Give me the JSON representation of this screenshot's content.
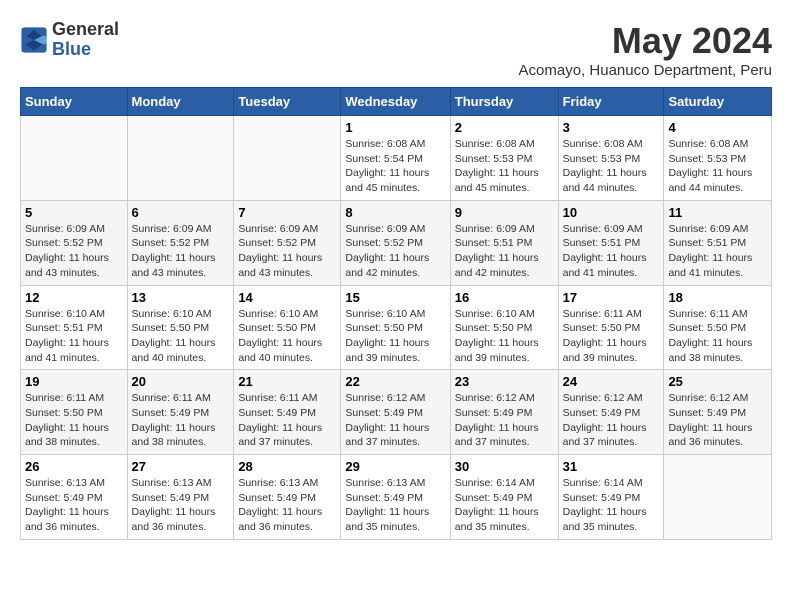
{
  "header": {
    "logo_general": "General",
    "logo_blue": "Blue",
    "month_year": "May 2024",
    "location": "Acomayo, Huanuco Department, Peru"
  },
  "calendar": {
    "days_of_week": [
      "Sunday",
      "Monday",
      "Tuesday",
      "Wednesday",
      "Thursday",
      "Friday",
      "Saturday"
    ],
    "weeks": [
      [
        {
          "day": "",
          "detail": ""
        },
        {
          "day": "",
          "detail": ""
        },
        {
          "day": "",
          "detail": ""
        },
        {
          "day": "1",
          "detail": "Sunrise: 6:08 AM\nSunset: 5:54 PM\nDaylight: 11 hours and 45 minutes."
        },
        {
          "day": "2",
          "detail": "Sunrise: 6:08 AM\nSunset: 5:53 PM\nDaylight: 11 hours and 45 minutes."
        },
        {
          "day": "3",
          "detail": "Sunrise: 6:08 AM\nSunset: 5:53 PM\nDaylight: 11 hours and 44 minutes."
        },
        {
          "day": "4",
          "detail": "Sunrise: 6:08 AM\nSunset: 5:53 PM\nDaylight: 11 hours and 44 minutes."
        }
      ],
      [
        {
          "day": "5",
          "detail": "Sunrise: 6:09 AM\nSunset: 5:52 PM\nDaylight: 11 hours and 43 minutes."
        },
        {
          "day": "6",
          "detail": "Sunrise: 6:09 AM\nSunset: 5:52 PM\nDaylight: 11 hours and 43 minutes."
        },
        {
          "day": "7",
          "detail": "Sunrise: 6:09 AM\nSunset: 5:52 PM\nDaylight: 11 hours and 43 minutes."
        },
        {
          "day": "8",
          "detail": "Sunrise: 6:09 AM\nSunset: 5:52 PM\nDaylight: 11 hours and 42 minutes."
        },
        {
          "day": "9",
          "detail": "Sunrise: 6:09 AM\nSunset: 5:51 PM\nDaylight: 11 hours and 42 minutes."
        },
        {
          "day": "10",
          "detail": "Sunrise: 6:09 AM\nSunset: 5:51 PM\nDaylight: 11 hours and 41 minutes."
        },
        {
          "day": "11",
          "detail": "Sunrise: 6:09 AM\nSunset: 5:51 PM\nDaylight: 11 hours and 41 minutes."
        }
      ],
      [
        {
          "day": "12",
          "detail": "Sunrise: 6:10 AM\nSunset: 5:51 PM\nDaylight: 11 hours and 41 minutes."
        },
        {
          "day": "13",
          "detail": "Sunrise: 6:10 AM\nSunset: 5:50 PM\nDaylight: 11 hours and 40 minutes."
        },
        {
          "day": "14",
          "detail": "Sunrise: 6:10 AM\nSunset: 5:50 PM\nDaylight: 11 hours and 40 minutes."
        },
        {
          "day": "15",
          "detail": "Sunrise: 6:10 AM\nSunset: 5:50 PM\nDaylight: 11 hours and 39 minutes."
        },
        {
          "day": "16",
          "detail": "Sunrise: 6:10 AM\nSunset: 5:50 PM\nDaylight: 11 hours and 39 minutes."
        },
        {
          "day": "17",
          "detail": "Sunrise: 6:11 AM\nSunset: 5:50 PM\nDaylight: 11 hours and 39 minutes."
        },
        {
          "day": "18",
          "detail": "Sunrise: 6:11 AM\nSunset: 5:50 PM\nDaylight: 11 hours and 38 minutes."
        }
      ],
      [
        {
          "day": "19",
          "detail": "Sunrise: 6:11 AM\nSunset: 5:50 PM\nDaylight: 11 hours and 38 minutes."
        },
        {
          "day": "20",
          "detail": "Sunrise: 6:11 AM\nSunset: 5:49 PM\nDaylight: 11 hours and 38 minutes."
        },
        {
          "day": "21",
          "detail": "Sunrise: 6:11 AM\nSunset: 5:49 PM\nDaylight: 11 hours and 37 minutes."
        },
        {
          "day": "22",
          "detail": "Sunrise: 6:12 AM\nSunset: 5:49 PM\nDaylight: 11 hours and 37 minutes."
        },
        {
          "day": "23",
          "detail": "Sunrise: 6:12 AM\nSunset: 5:49 PM\nDaylight: 11 hours and 37 minutes."
        },
        {
          "day": "24",
          "detail": "Sunrise: 6:12 AM\nSunset: 5:49 PM\nDaylight: 11 hours and 37 minutes."
        },
        {
          "day": "25",
          "detail": "Sunrise: 6:12 AM\nSunset: 5:49 PM\nDaylight: 11 hours and 36 minutes."
        }
      ],
      [
        {
          "day": "26",
          "detail": "Sunrise: 6:13 AM\nSunset: 5:49 PM\nDaylight: 11 hours and 36 minutes."
        },
        {
          "day": "27",
          "detail": "Sunrise: 6:13 AM\nSunset: 5:49 PM\nDaylight: 11 hours and 36 minutes."
        },
        {
          "day": "28",
          "detail": "Sunrise: 6:13 AM\nSunset: 5:49 PM\nDaylight: 11 hours and 36 minutes."
        },
        {
          "day": "29",
          "detail": "Sunrise: 6:13 AM\nSunset: 5:49 PM\nDaylight: 11 hours and 35 minutes."
        },
        {
          "day": "30",
          "detail": "Sunrise: 6:14 AM\nSunset: 5:49 PM\nDaylight: 11 hours and 35 minutes."
        },
        {
          "day": "31",
          "detail": "Sunrise: 6:14 AM\nSunset: 5:49 PM\nDaylight: 11 hours and 35 minutes."
        },
        {
          "day": "",
          "detail": ""
        }
      ]
    ]
  }
}
